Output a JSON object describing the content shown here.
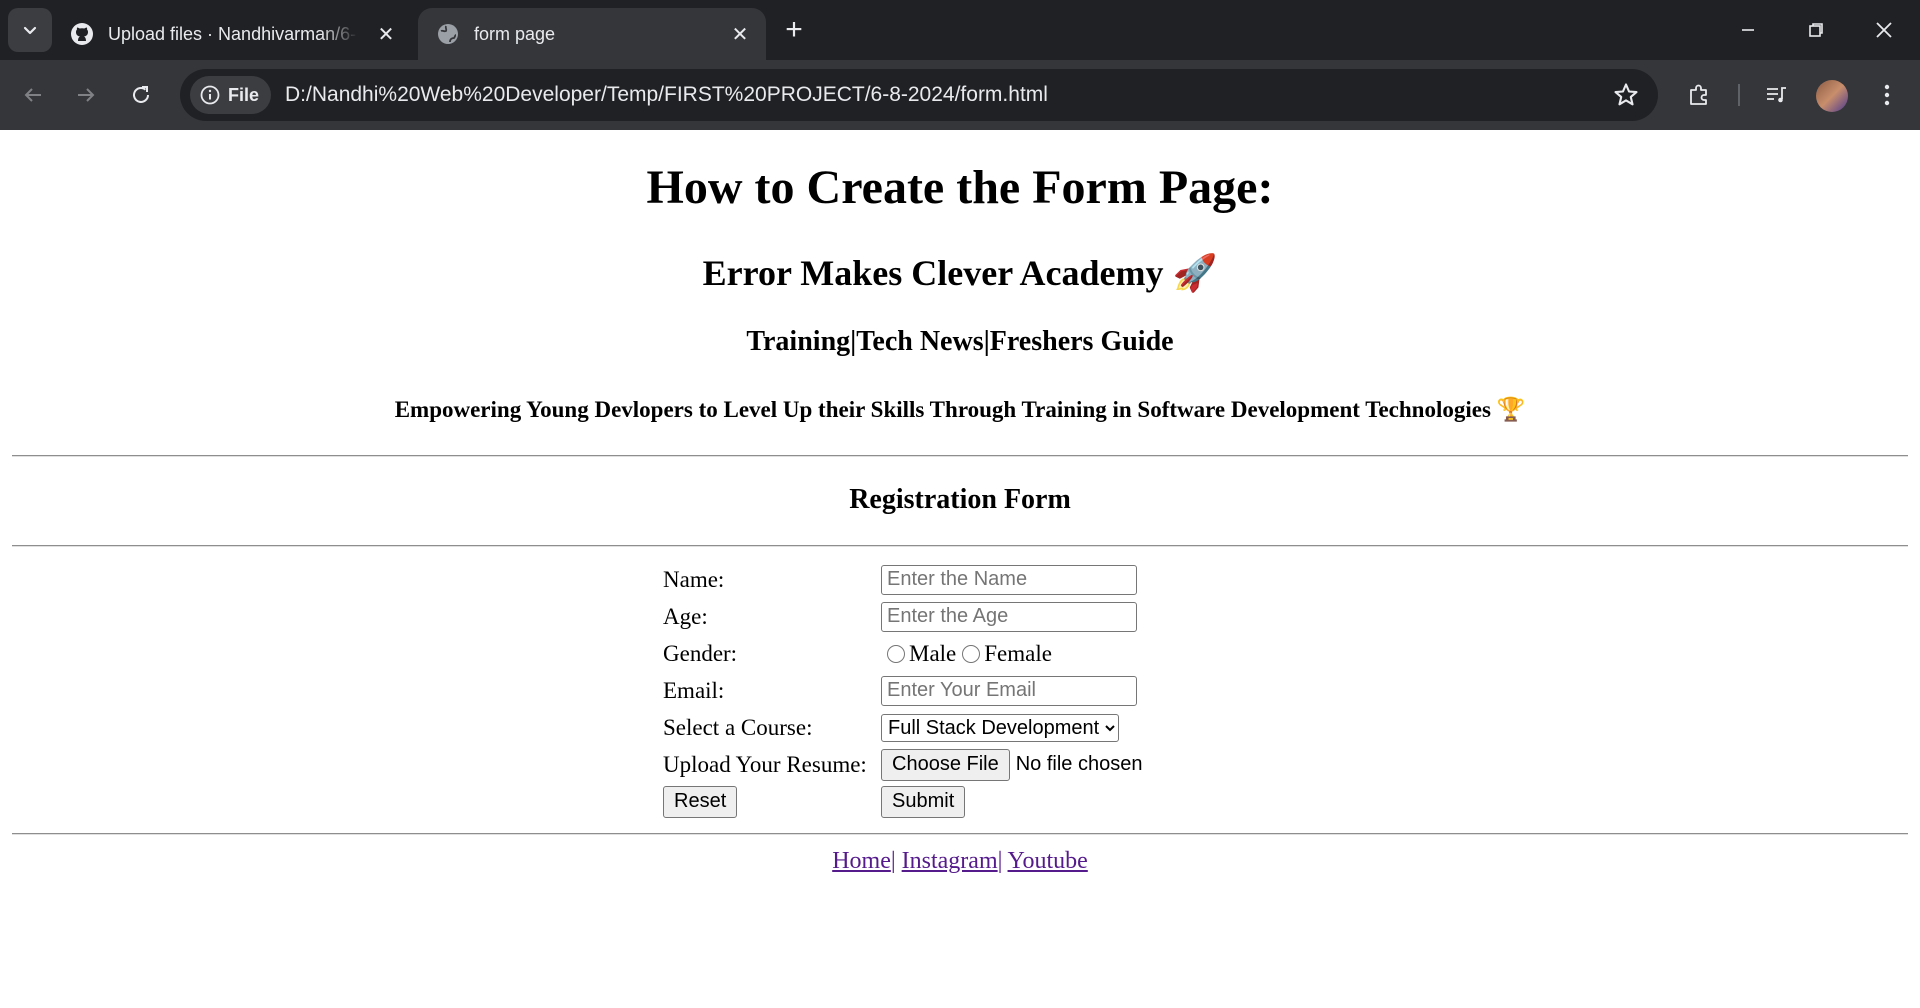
{
  "browser": {
    "tabs": [
      {
        "title": "Upload files · Nandhivarman/6-",
        "icon": "github-icon",
        "active": false
      },
      {
        "title": "form page",
        "icon": "globe-icon",
        "active": true
      }
    ],
    "address": {
      "chip_label": "File",
      "url": "D:/Nandhi%20Web%20Developer/Temp/FIRST%20PROJECT/6-8-2024/form.html"
    }
  },
  "page": {
    "title": "How to Create the Form Page:",
    "academy": "Error Makes Clever Academy 🚀",
    "tagline": "Training|Tech News|Freshers Guide",
    "mission": "Empowering Young Devlopers to Level Up their Skills Through Training in Software Development Technologies 🏆",
    "form_title": "Registration Form"
  },
  "form": {
    "name_label": "Name:",
    "name_placeholder": "Enter the Name",
    "age_label": "Age:",
    "age_placeholder": "Enter the Age",
    "gender_label": "Gender:",
    "gender_male": "Male",
    "gender_female": "Female",
    "email_label": "Email:",
    "email_placeholder": "Enter Your Email",
    "course_label": "Select a Course:",
    "course_selected": "Full Stack Development",
    "resume_label": "Upload Your Resume:",
    "choose_file": "Choose File",
    "file_status": "No file chosen",
    "reset": "Reset",
    "submit": "Submit"
  },
  "footer": {
    "home": "Home",
    "instagram": "Instagram",
    "youtube": "Youtube",
    "separator": "|"
  },
  "colors": {
    "chrome_dark": "#202124",
    "chrome_toolbar": "#35363a",
    "visited_link": "#551a8b"
  }
}
